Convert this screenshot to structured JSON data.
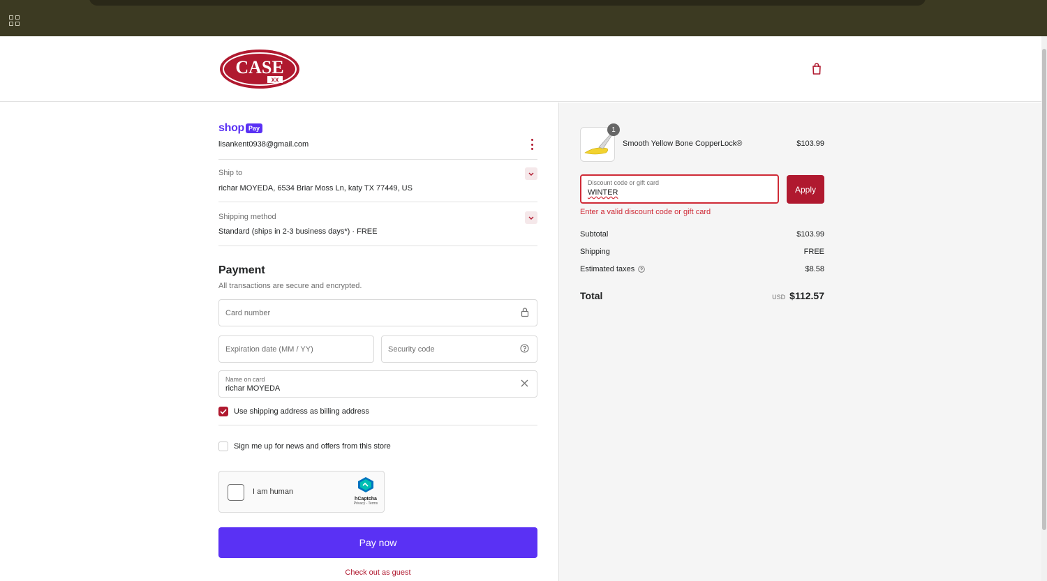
{
  "header": {
    "logo_text": "CASE",
    "logo_sub": "XX"
  },
  "contact": {
    "email": "lisankent0938@gmail.com",
    "shop_label": "shop",
    "pay_label": "Pay"
  },
  "ship_to": {
    "label": "Ship to",
    "value": "richar MOYEDA, 6534 Briar Moss Ln, katy TX 77449, US"
  },
  "shipping_method": {
    "label": "Shipping method",
    "value": "Standard (ships in 2-3 business days*) · FREE"
  },
  "payment": {
    "title": "Payment",
    "subtitle": "All transactions are secure and encrypted.",
    "card_number_placeholder": "Card number",
    "expiration_placeholder": "Expiration date (MM / YY)",
    "security_placeholder": "Security code",
    "name_label": "Name on card",
    "name_value": "richar MOYEDA",
    "billing_checkbox_label": "Use shipping address as billing address",
    "billing_checked": true,
    "newsletter_label": "Sign me up for news and offers from this store",
    "newsletter_checked": false
  },
  "captcha": {
    "label": "I am human",
    "brand": "hCaptcha",
    "links": "Privacy - Terms"
  },
  "actions": {
    "pay_now": "Pay now",
    "guest": "Check out as guest"
  },
  "order": {
    "item": {
      "name": "Smooth Yellow Bone CopperLock®",
      "price": "$103.99",
      "quantity": "1"
    },
    "discount": {
      "label": "Discount code or gift card",
      "value": "WINTER",
      "apply": "Apply",
      "error": "Enter a valid discount code or gift card"
    },
    "summary": {
      "subtotal_label": "Subtotal",
      "subtotal": "$103.99",
      "shipping_label": "Shipping",
      "shipping": "FREE",
      "taxes_label": "Estimated taxes",
      "taxes": "$8.58",
      "total_label": "Total",
      "currency": "USD",
      "total": "$112.57"
    }
  },
  "colors": {
    "brand_red": "#b0192f",
    "shop_purple": "#5a31f4",
    "error": "#cf2a36"
  }
}
